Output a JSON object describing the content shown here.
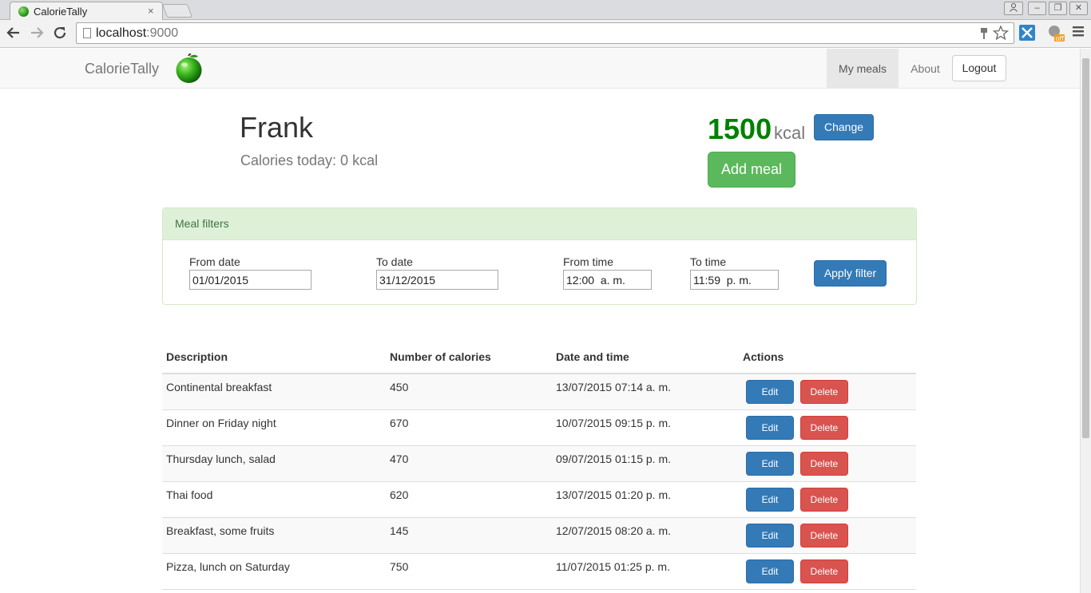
{
  "browser": {
    "tab_title": "CalorieTally",
    "tab_close": "×",
    "url_host": "localhost",
    "url_port": ":9000",
    "minimize": "–",
    "restore": "❐",
    "close": "✕"
  },
  "navbar": {
    "brand": "CalorieTally",
    "items": [
      {
        "label": "My meals",
        "active": true
      },
      {
        "label": "About",
        "active": false
      }
    ],
    "logout_label": "Logout"
  },
  "profile": {
    "name": "Frank",
    "calories_today": "Calories today: 0 kcal",
    "goal_value": "1500",
    "goal_unit": "kcal",
    "change_label": "Change",
    "add_meal_label": "Add meal"
  },
  "filters": {
    "heading": "Meal filters",
    "from_date_label": "From date",
    "from_date_value": "01/01/2015",
    "to_date_label": "To date",
    "to_date_value": "31/12/2015",
    "from_time_label": "From time",
    "from_time_value": "12:00  a. m.",
    "to_time_label": "To time",
    "to_time_value": "11:59  p. m.",
    "apply_label": "Apply filter"
  },
  "table": {
    "headers": [
      "Description",
      "Number of calories",
      "Date and time",
      "Actions"
    ],
    "edit_label": "Edit",
    "delete_label": "Delete",
    "rows": [
      {
        "description": "Continental breakfast",
        "calories": "450",
        "datetime": "13/07/2015 07:14 a. m."
      },
      {
        "description": "Dinner on Friday night",
        "calories": "670",
        "datetime": "10/07/2015 09:15 p. m."
      },
      {
        "description": "Thursday lunch, salad",
        "calories": "470",
        "datetime": "09/07/2015 01:15 p. m."
      },
      {
        "description": "Thai food",
        "calories": "620",
        "datetime": "13/07/2015 01:20 p. m."
      },
      {
        "description": "Breakfast, some fruits",
        "calories": "145",
        "datetime": "12/07/2015 08:20 a. m."
      },
      {
        "description": "Pizza, lunch on Saturday",
        "calories": "750",
        "datetime": "11/07/2015 01:25 p. m."
      }
    ]
  },
  "colors": {
    "primary": "#337ab7",
    "success": "#5cb85c",
    "danger": "#d9534f",
    "goal_green": "#008000"
  }
}
